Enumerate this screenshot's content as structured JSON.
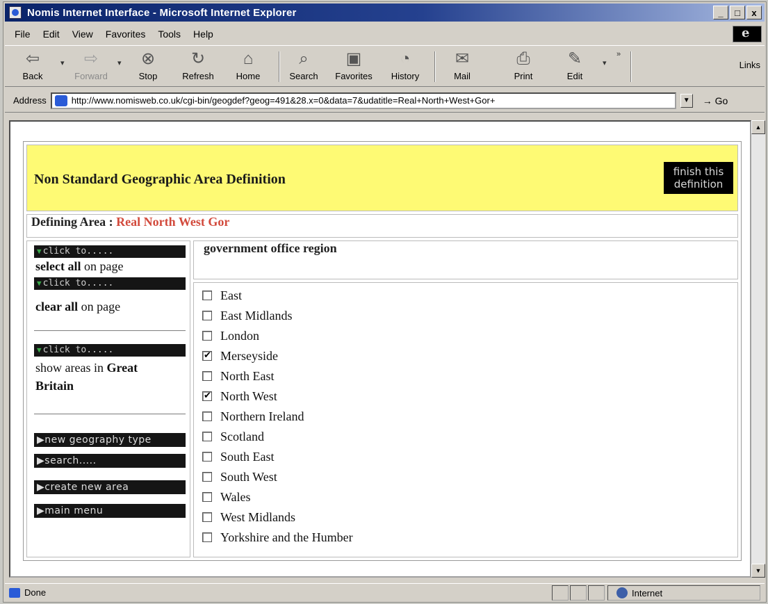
{
  "window": {
    "title": "Nomis Internet Interface - Microsoft Internet Explorer",
    "buttons": {
      "minimize": "_",
      "maximize": "□",
      "close": "x"
    }
  },
  "menu": [
    "File",
    "Edit",
    "View",
    "Favorites",
    "Tools",
    "Help"
  ],
  "toolbar": {
    "back": "Back",
    "forward": "Forward",
    "stop": "Stop",
    "refresh": "Refresh",
    "home": "Home",
    "search": "Search",
    "favorites": "Favorites",
    "history": "History",
    "mail": "Mail",
    "print": "Print",
    "edit": "Edit",
    "links": "Links"
  },
  "address": {
    "label": "Address",
    "url": "http://www.nomisweb.co.uk/cgi-bin/geogdef?geog=491&28.x=0&data=7&udatitle=Real+North+West+Gor+",
    "go": "Go"
  },
  "page": {
    "title": "Non Standard Geographic Area Definition",
    "finish_line1": "finish this",
    "finish_line2": "definition",
    "defining_label": "Defining Area :",
    "defining_value": "Real North West Gor",
    "column_header": "government office region",
    "sidebar": {
      "click_to": "click to.....",
      "select_all_bold": "select all",
      "select_all_rest": " on page",
      "clear_all_bold": "clear all",
      "clear_all_rest": " on page",
      "show_areas_text": "show areas in ",
      "show_areas_bold_1": "Great",
      "show_areas_bold_2": "Britain",
      "new_geography": "new geography type",
      "search": "search.....",
      "create_new": "create new area",
      "main_menu": "main menu"
    },
    "regions": [
      {
        "name": "East",
        "checked": false
      },
      {
        "name": "East Midlands",
        "checked": false
      },
      {
        "name": "London",
        "checked": false
      },
      {
        "name": "Merseyside",
        "checked": true
      },
      {
        "name": "North East",
        "checked": false
      },
      {
        "name": "North West",
        "checked": true
      },
      {
        "name": "Northern Ireland",
        "checked": false
      },
      {
        "name": "Scotland",
        "checked": false
      },
      {
        "name": "South East",
        "checked": false
      },
      {
        "name": "South West",
        "checked": false
      },
      {
        "name": "Wales",
        "checked": false
      },
      {
        "name": "West Midlands",
        "checked": false
      },
      {
        "name": "Yorkshire and the Humber",
        "checked": false
      }
    ]
  },
  "status": {
    "left": "Done",
    "zone": "Internet"
  },
  "colors": {
    "banner": "#fefa74",
    "defining_area": "#d24a3c",
    "title_bar": "#0a246a"
  }
}
